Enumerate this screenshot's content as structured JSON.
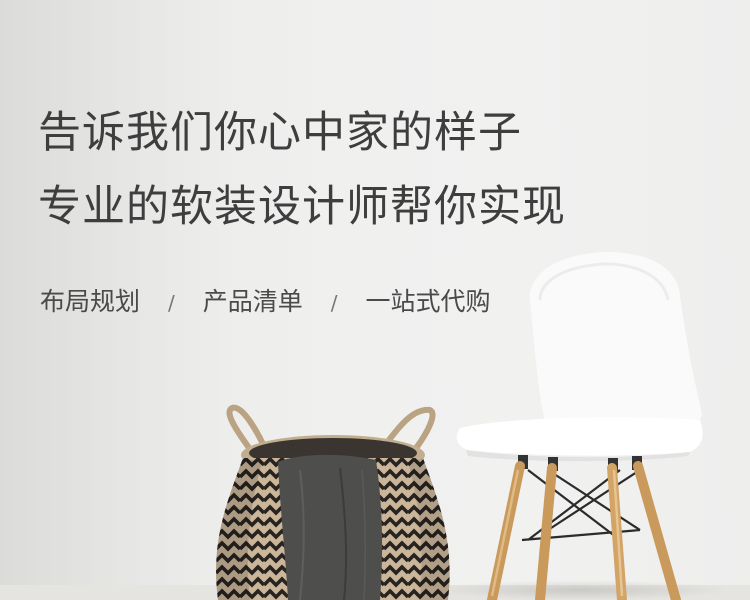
{
  "headline": {
    "line1": "告诉我们你心中家的样子",
    "line2": "专业的软装设计师帮你实现"
  },
  "services": {
    "items": [
      "布局规划",
      "产品清单",
      "一站式代购"
    ],
    "separator": "/"
  },
  "colors": {
    "headline_text": "#3e3e3e",
    "service_text": "#4a4a4a",
    "wall": "#f0f0ef"
  }
}
